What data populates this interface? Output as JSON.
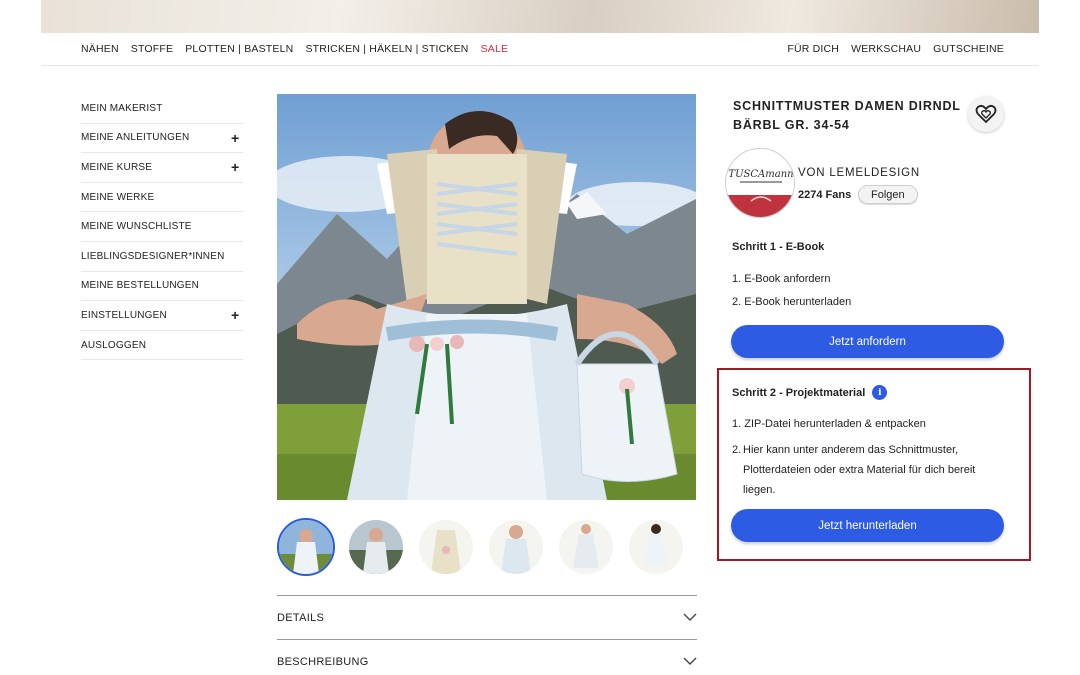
{
  "top_nav": {
    "left": [
      "NÄHEN",
      "STOFFE",
      "PLOTTEN | BASTELN",
      "STRICKEN | HÄKELN | STICKEN",
      "SALE"
    ],
    "right": [
      "FÜR DICH",
      "WERKSCHAU",
      "GUTSCHEINE"
    ],
    "sale_color": "#d6283a"
  },
  "sidebar": {
    "items": [
      {
        "label": "MEIN MAKERIST",
        "expandable": false
      },
      {
        "label": "MEINE ANLEITUNGEN",
        "expandable": true
      },
      {
        "label": "MEINE KURSE",
        "expandable": true
      },
      {
        "label": "MEINE WERKE",
        "expandable": false
      },
      {
        "label": "MEINE WUNSCHLISTE",
        "expandable": false
      },
      {
        "label": "LIEBLINGSDESIGNER*INNEN",
        "expandable": false
      },
      {
        "label": "MEINE BESTELLUNGEN",
        "expandable": false
      },
      {
        "label": "EINSTELLUNGEN",
        "expandable": true
      },
      {
        "label": "AUSLOGGEN",
        "expandable": false
      }
    ],
    "plus_symbol": "+"
  },
  "product": {
    "title": "SCHNITTMUSTER DAMEN DIRNDL BÄRBL GR. 34-54",
    "designer": "VON LEMELDESIGN",
    "fans": "2274 Fans",
    "follow_label": "Folgen",
    "avatar_text": "TUSCAmann"
  },
  "step1": {
    "title": "Schritt 1 - E-Book",
    "items": [
      "1. E-Book anfordern",
      "2. E-Book herunterladen"
    ],
    "button": "Jetzt anfordern"
  },
  "step2": {
    "title": "Schritt 2 - Projektmaterial",
    "info_symbol": "i",
    "item1": "1. ZIP-Datei herunterladen & entpacken",
    "item2_num": "2.",
    "item2_text": "Hier kann unter anderem das Schnittmuster, Plotterdateien oder extra Material für dich bereit liegen.",
    "button": "Jetzt herunterladen"
  },
  "accordion": {
    "details": "DETAILS",
    "description": "BESCHREIBUNG"
  },
  "thumbnails": {
    "count": 6,
    "active_index": 0
  },
  "colors": {
    "primary_button": "#2e5be3",
    "highlight_border": "#a41624"
  }
}
